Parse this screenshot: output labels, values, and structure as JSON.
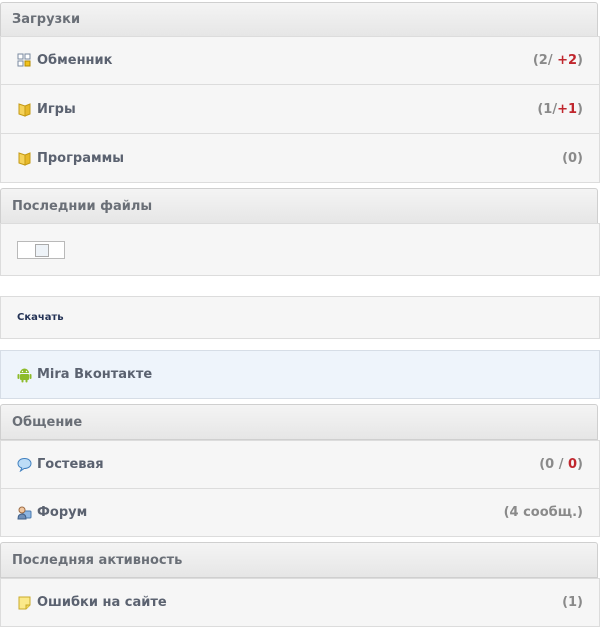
{
  "sections": {
    "downloads": {
      "title": "Загрузки"
    },
    "latest_files": {
      "title": "Последнии файлы"
    },
    "communication": {
      "title": "Общение"
    },
    "activity": {
      "title": "Последняя активность"
    }
  },
  "downloads_items": [
    {
      "label": "Обменник",
      "count_prefix": "(2/ ",
      "count_new": "+2",
      "count_suffix": ")",
      "icon": "grid-icon"
    },
    {
      "label": "Игры",
      "count_prefix": "(1/",
      "count_new": "+1",
      "count_suffix": ")",
      "icon": "folder-icon"
    },
    {
      "label": "Программы",
      "count": "(0)",
      "icon": "folder-icon"
    }
  ],
  "latest_files": {
    "download_label": "Скачать"
  },
  "promo": {
    "label": "Mira Вконтакте",
    "icon": "android-icon"
  },
  "communication_items": [
    {
      "label": "Гостевая",
      "count_prefix": "(0 / ",
      "count_new": "0",
      "count_suffix": ")",
      "icon": "speech-bubble-icon"
    },
    {
      "label": "Форум",
      "count": "(4 сообщ.)",
      "icon": "forum-user-icon"
    }
  ],
  "activity_items": [
    {
      "label": "Ошибки на сайте",
      "count": "(1)",
      "icon": "note-icon"
    }
  ]
}
